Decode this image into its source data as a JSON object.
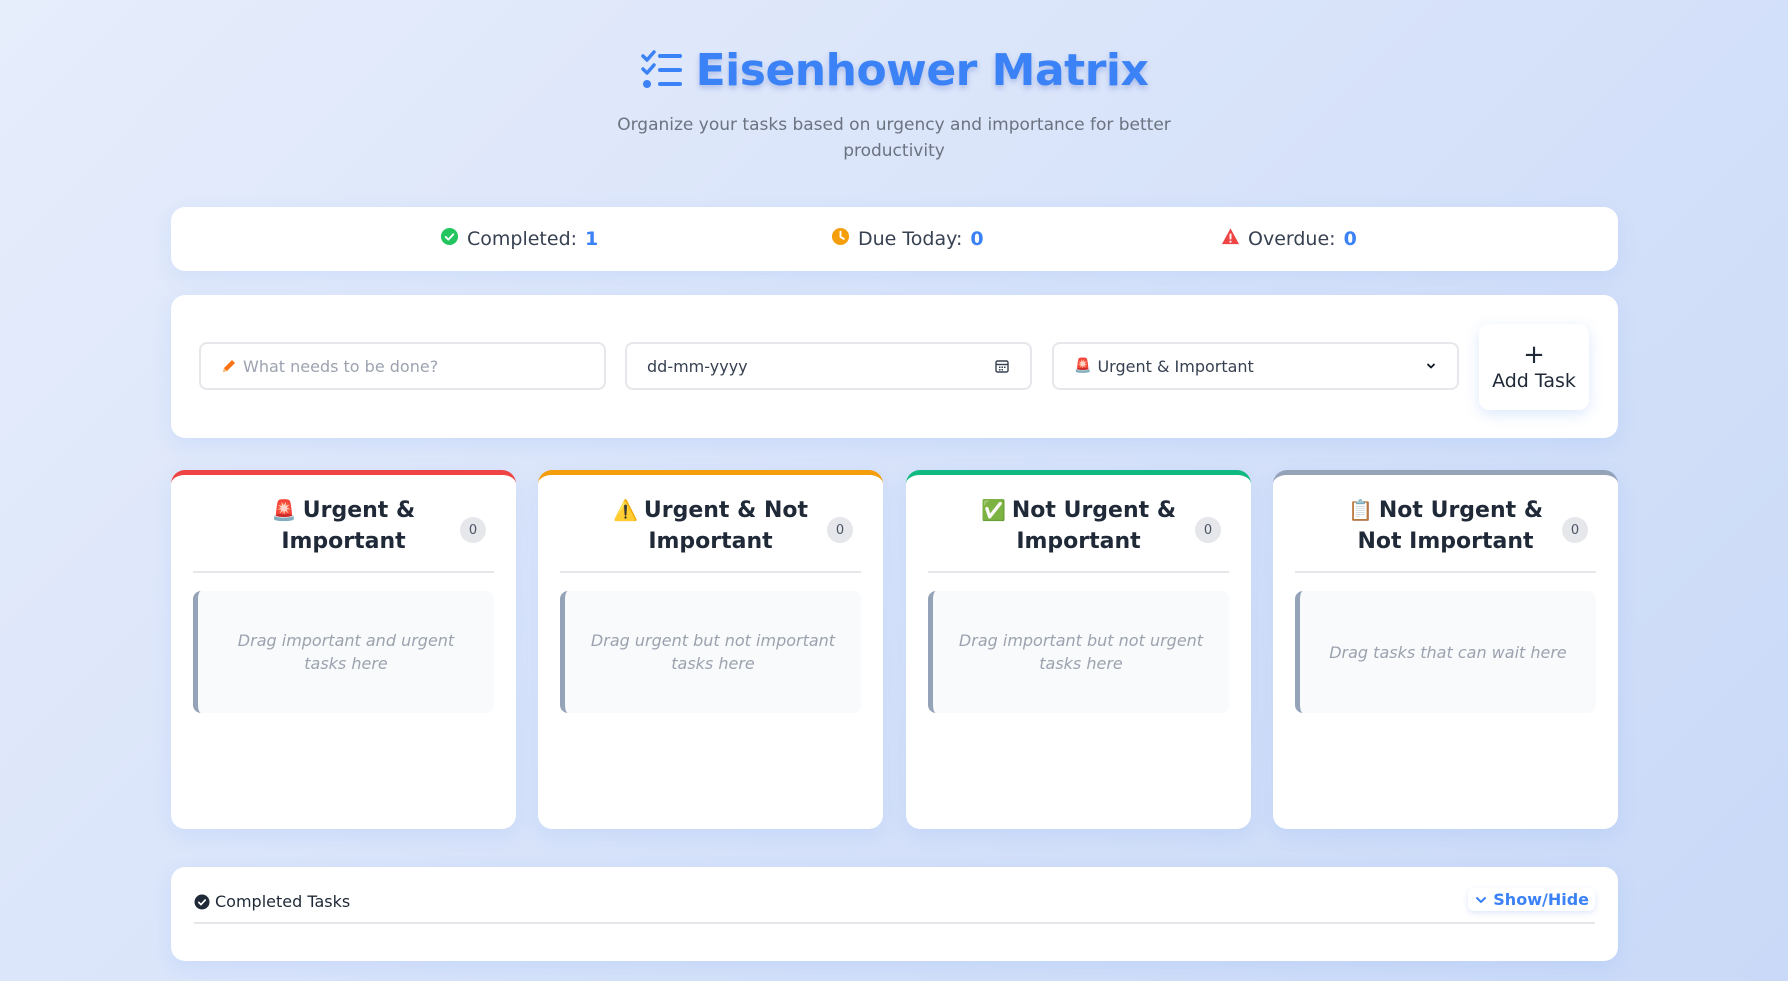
{
  "header": {
    "title": "Eisenhower Matrix",
    "subtitle": "Organize your tasks based on urgency and importance for better productivity",
    "icon": "tasks-list-icon"
  },
  "stats": [
    {
      "label": "Completed: ",
      "value": "1",
      "icon": "check-circle-icon",
      "color": "#22c55e"
    },
    {
      "label": "Due Today: ",
      "value": "0",
      "icon": "clock-icon",
      "color": "#f59e0b"
    },
    {
      "label": "Overdue: ",
      "value": "0",
      "icon": "warning-triangle-icon",
      "color": "#ef4444"
    }
  ],
  "form": {
    "task_placeholder": "What needs to be done?",
    "date_placeholder": "dd-mm-yyyy",
    "category_selected": "Urgent & Important",
    "category_emoji": "🚨",
    "add_plus": "+",
    "add_label": "Add Task"
  },
  "quadrants": [
    {
      "emoji": "🚨",
      "title": "Urgent & Important",
      "count": "0",
      "placeholder": "Drag important and urgent tasks here",
      "color": "#ef4444"
    },
    {
      "emoji": "⚠️",
      "title": "Urgent & Not Important",
      "count": "0",
      "placeholder": "Drag urgent but not important tasks here",
      "color": "#f59e0b"
    },
    {
      "emoji": "✅",
      "title": "Not Urgent & Important",
      "count": "0",
      "placeholder": "Drag important but not urgent tasks here",
      "color": "#10b981"
    },
    {
      "emoji": "📋",
      "title": "Not Urgent & Not Important",
      "count": "0",
      "placeholder": "Drag tasks that can wait here",
      "color": "#94a3b8"
    }
  ],
  "completed": {
    "label": "Completed Tasks",
    "toggle_label": "Show/Hide"
  },
  "colors": {
    "accent": "#3b82f6",
    "urgent_important": "#ef4444",
    "urgent_not_important": "#f59e0b",
    "not_urgent_important": "#10b981",
    "not_urgent_not_important": "#94a3b8"
  }
}
